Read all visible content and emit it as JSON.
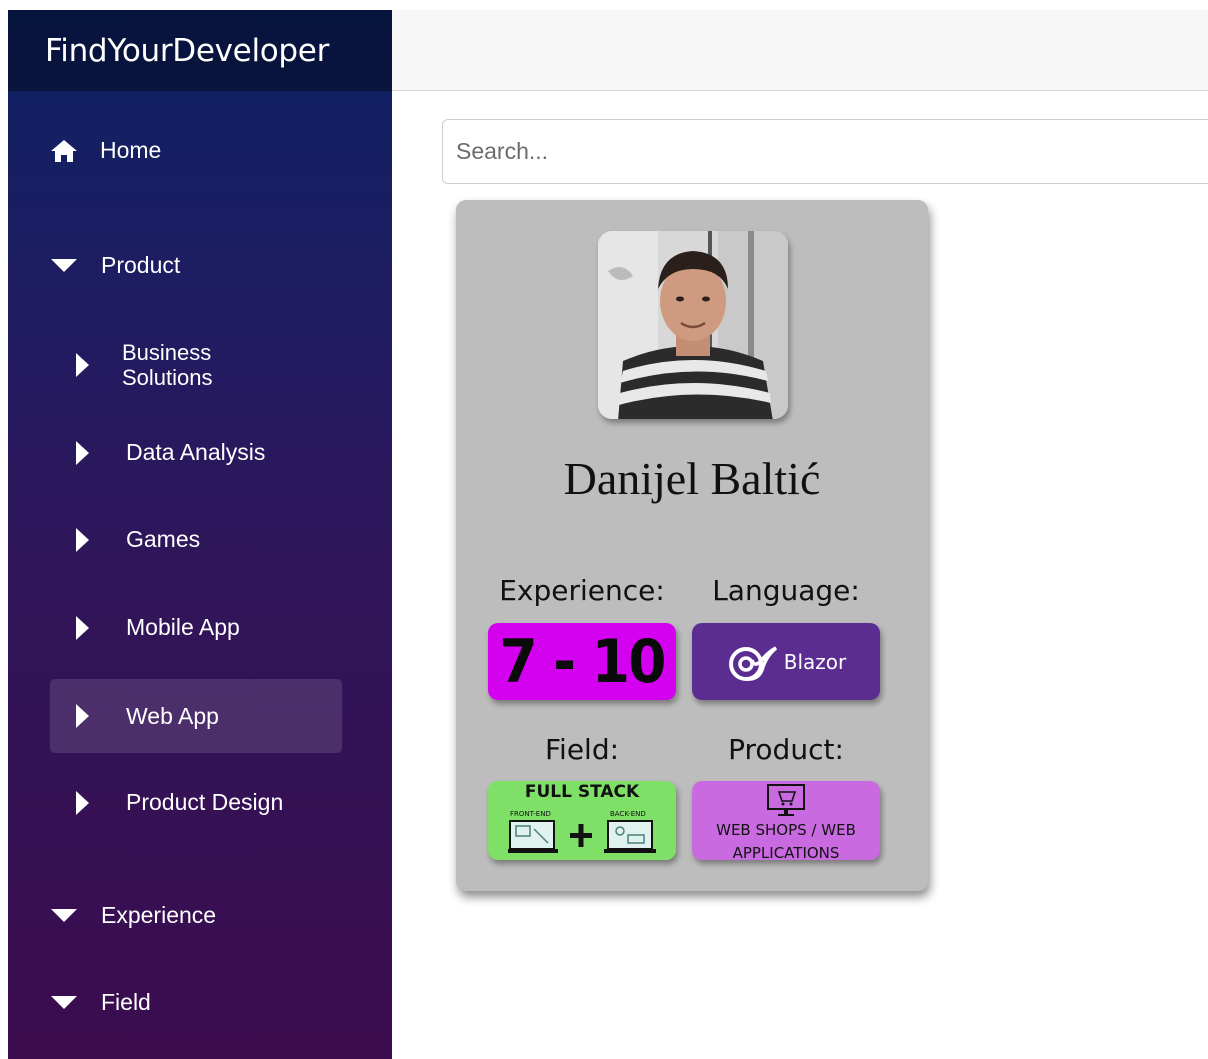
{
  "app": {
    "title": "FindYourDeveloper"
  },
  "sidebar": {
    "items": [
      {
        "label": "Home",
        "icon": "home-icon"
      },
      {
        "label": "Product",
        "icon": "caret-down-icon"
      },
      {
        "label": "Business Solutions",
        "icon": "caret-right-icon"
      },
      {
        "label": "Data Analysis",
        "icon": "caret-right-icon"
      },
      {
        "label": "Games",
        "icon": "caret-right-icon"
      },
      {
        "label": "Mobile App",
        "icon": "caret-right-icon"
      },
      {
        "label": "Web App",
        "icon": "caret-right-icon",
        "active": true
      },
      {
        "label": "Product Design",
        "icon": "caret-right-icon"
      },
      {
        "label": "Experience",
        "icon": "caret-down-icon"
      },
      {
        "label": "Field",
        "icon": "caret-down-icon"
      }
    ],
    "business_line1": "Business",
    "business_line2": "Solutions"
  },
  "search": {
    "placeholder": "Search...",
    "value": ""
  },
  "card": {
    "name": "Danijel Baltić",
    "experience_label": "Experience:",
    "experience_value": "7 - 10",
    "language_label": "Language:",
    "language_value": "Blazor",
    "field_label": "Field:",
    "field_value": "FULL STACK",
    "field_front": "FRONT-END",
    "field_back": "BACK-END",
    "product_label": "Product:",
    "product_line1": "WEB SHOPS / WEB",
    "product_line2": "APPLICATIONS"
  },
  "colors": {
    "sidebar_top": "#0b2263",
    "sidebar_bottom": "#3a0c4e",
    "experience_badge": "#d400f0",
    "language_badge": "#5c2d91",
    "field_badge": "#7fe067",
    "product_badge": "#c96ae0"
  }
}
